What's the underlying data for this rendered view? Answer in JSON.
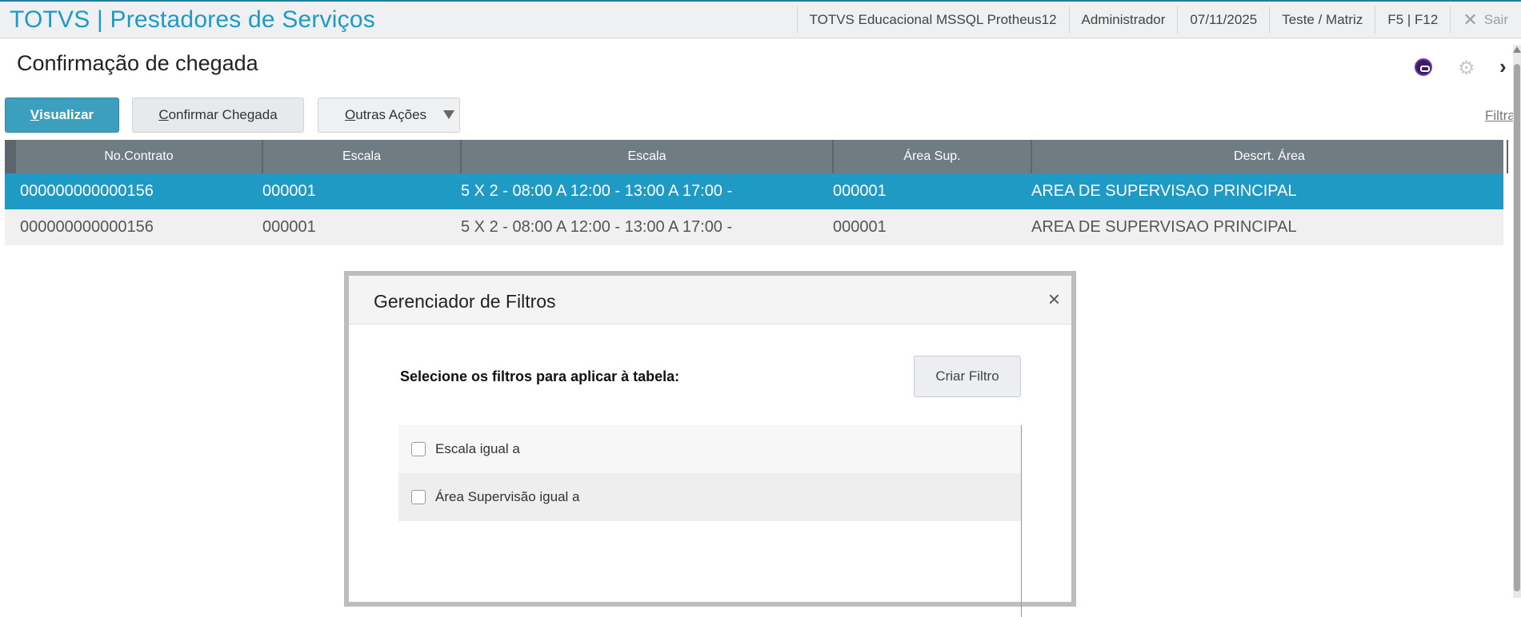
{
  "app": {
    "title": "TOTVS | Prestadores de Serviços"
  },
  "topbar": {
    "environment": "TOTVS Educacional MSSQL Protheus12",
    "user": "Administrador",
    "date": "07/11/2025",
    "branch": "Teste / Matriz",
    "shortcuts": "F5 | F12",
    "exit_label": "Sair"
  },
  "page": {
    "title": "Confirmação de chegada"
  },
  "toolbar": {
    "visualizar_rest": "isualizar",
    "visualizar_key": "V",
    "confirmar_key": "C",
    "confirmar_rest": "onfirmar Chegada",
    "outras_key": "O",
    "outras_rest": "utras Ações",
    "filtrar_label": "Filtrar"
  },
  "grid": {
    "columns": [
      "No.Contrato",
      "Escala",
      "Escala",
      "Área Sup.",
      "Descrt. Área"
    ],
    "rows": [
      [
        "000000000000156",
        "000001",
        "5 X 2 - 08:00 A 12:00 - 13:00 A 17:00 -",
        "000001",
        "AREA DE SUPERVISAO PRINCIPAL"
      ],
      [
        "000000000000156",
        "000001",
        "5 X 2 - 08:00 A 12:00 - 13:00 A 17:00 -",
        "000001",
        "AREA DE SUPERVISAO PRINCIPAL"
      ]
    ]
  },
  "modal": {
    "title": "Gerenciador de Filtros",
    "close_glyph": "×",
    "instruction": "Selecione os filtros para aplicar à tabela:",
    "create_button": "Criar Filtro",
    "filters": [
      {
        "label": "Escala igual a",
        "checked": false
      },
      {
        "label": "Área Supervisão igual a",
        "checked": false
      }
    ]
  },
  "colors": {
    "accent": "#1e9ac4",
    "header_gray": "#6f7c82",
    "primary_button": "#3b9fbd"
  },
  "icons": {
    "user_badge": "user-badge-icon",
    "settings": "gear-icon",
    "nav": "chevron-right-icon",
    "close": "close-icon"
  }
}
